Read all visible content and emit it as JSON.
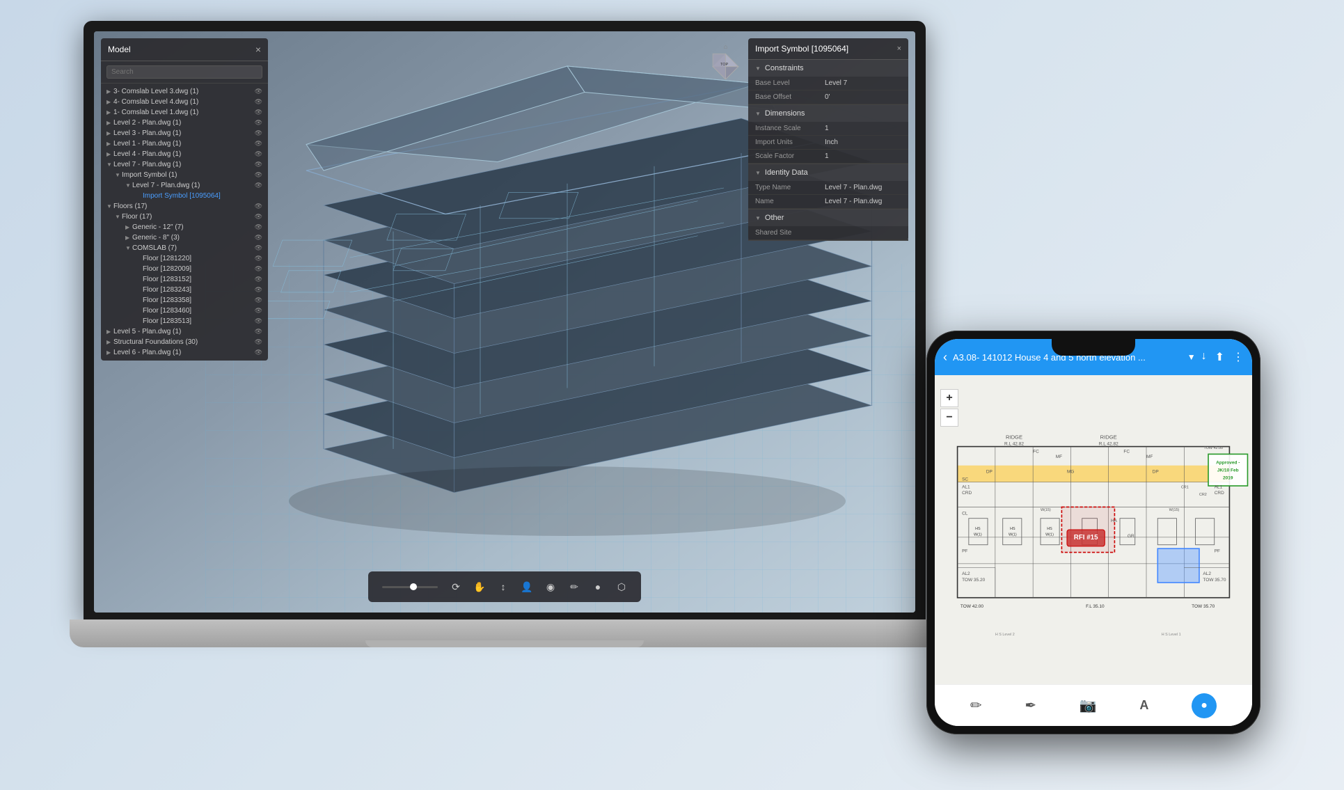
{
  "laptop": {
    "model_panel": {
      "title": "Model",
      "close_btn": "×",
      "search_placeholder": "Search",
      "tree_items": [
        {
          "label": "3- Comslab Level 3.dwg (1)",
          "indent": 0,
          "has_arrow": true,
          "arrow": "▶"
        },
        {
          "label": "4- Comslab Level 4.dwg (1)",
          "indent": 0,
          "has_arrow": true,
          "arrow": "▶"
        },
        {
          "label": "1- Comslab Level 1.dwg (1)",
          "indent": 0,
          "has_arrow": true,
          "arrow": "▶"
        },
        {
          "label": "Level 2 - Plan.dwg (1)",
          "indent": 0,
          "has_arrow": true,
          "arrow": "▶"
        },
        {
          "label": "Level 3 - Plan.dwg (1)",
          "indent": 0,
          "has_arrow": true,
          "arrow": "▶"
        },
        {
          "label": "Level 1 - Plan.dwg (1)",
          "indent": 0,
          "has_arrow": true,
          "arrow": "▶"
        },
        {
          "label": "Level 4 - Plan.dwg (1)",
          "indent": 0,
          "has_arrow": true,
          "arrow": "▶"
        },
        {
          "label": "Level 7 - Plan.dwg (1)",
          "indent": 0,
          "has_arrow": true,
          "arrow": "▼"
        },
        {
          "label": "Import Symbol (1)",
          "indent": 1,
          "has_arrow": true,
          "arrow": "▼"
        },
        {
          "label": "Level 7 - Plan.dwg (1)",
          "indent": 2,
          "has_arrow": true,
          "arrow": "▼"
        },
        {
          "label": "Import Symbol [1095064]",
          "indent": 3,
          "has_arrow": false,
          "arrow": "",
          "active": true
        },
        {
          "label": "Floors (17)",
          "indent": 0,
          "has_arrow": true,
          "arrow": "▼"
        },
        {
          "label": "Floor (17)",
          "indent": 1,
          "has_arrow": true,
          "arrow": "▼"
        },
        {
          "label": "Generic - 12\" (7)",
          "indent": 2,
          "has_arrow": true,
          "arrow": "▶"
        },
        {
          "label": "Generic - 8\" (3)",
          "indent": 2,
          "has_arrow": true,
          "arrow": "▶"
        },
        {
          "label": "COMSLAB (7)",
          "indent": 2,
          "has_arrow": true,
          "arrow": "▼"
        },
        {
          "label": "Floor [1281220]",
          "indent": 3,
          "has_arrow": false,
          "arrow": ""
        },
        {
          "label": "Floor [1282009]",
          "indent": 3,
          "has_arrow": false,
          "arrow": ""
        },
        {
          "label": "Floor [1283152]",
          "indent": 3,
          "has_arrow": false,
          "arrow": ""
        },
        {
          "label": "Floor [1283243]",
          "indent": 3,
          "has_arrow": false,
          "arrow": ""
        },
        {
          "label": "Floor [1283358]",
          "indent": 3,
          "has_arrow": false,
          "arrow": ""
        },
        {
          "label": "Floor [1283460]",
          "indent": 3,
          "has_arrow": false,
          "arrow": ""
        },
        {
          "label": "Floor [1283513]",
          "indent": 3,
          "has_arrow": false,
          "arrow": ""
        },
        {
          "label": "Level 5 - Plan.dwg (1)",
          "indent": 0,
          "has_arrow": true,
          "arrow": "▶"
        },
        {
          "label": "Structural Foundations (30)",
          "indent": 0,
          "has_arrow": true,
          "arrow": "▶"
        },
        {
          "label": "Level 6 - Plan.dwg (1)",
          "indent": 0,
          "has_arrow": true,
          "arrow": "▶"
        }
      ]
    },
    "properties_panel": {
      "title": "Import Symbol [1095064]",
      "close_btn": "×",
      "sections": [
        {
          "title": "Constraints",
          "rows": [
            {
              "key": "Base Level",
              "val": "Level 7"
            },
            {
              "key": "Base Offset",
              "val": "0'"
            }
          ]
        },
        {
          "title": "Dimensions",
          "rows": [
            {
              "key": "Instance Scale",
              "val": "1"
            },
            {
              "key": "Import Units",
              "val": "Inch"
            },
            {
              "key": "Scale Factor",
              "val": "1"
            }
          ]
        },
        {
          "title": "Identity Data",
          "rows": [
            {
              "key": "Type Name",
              "val": "Level 7 - Plan.dwg"
            },
            {
              "key": "Name",
              "val": "Level 7 - Plan.dwg"
            }
          ]
        },
        {
          "title": "Other",
          "rows": [
            {
              "key": "Shared Site",
              "val": ""
            }
          ]
        }
      ]
    },
    "toolbar": {
      "buttons": [
        "⟳",
        "✋",
        "↕",
        "👤",
        "◉",
        "✏",
        "●",
        "⬡"
      ]
    }
  },
  "phone": {
    "header": {
      "back_label": "‹",
      "title": "A3.08- 141012 House 4 and 5 north elevation ...",
      "dropdown_icon": "▼",
      "download_icon": "↓",
      "share_icon": "⬆",
      "more_icon": "⋮"
    },
    "map_controls": {
      "plus": "+",
      "minus": "−"
    },
    "blueprint": {
      "rfi_label": "RFI #15",
      "approved_label": "Approved -\nJK/10 Feb\n2019",
      "ridge_label": "RIDGE",
      "ridge_level": "R.L 42.82"
    },
    "toolbar": {
      "pencil": "✏",
      "marker": "✒",
      "camera": "📷",
      "text": "A",
      "circle_dot": "●"
    }
  }
}
